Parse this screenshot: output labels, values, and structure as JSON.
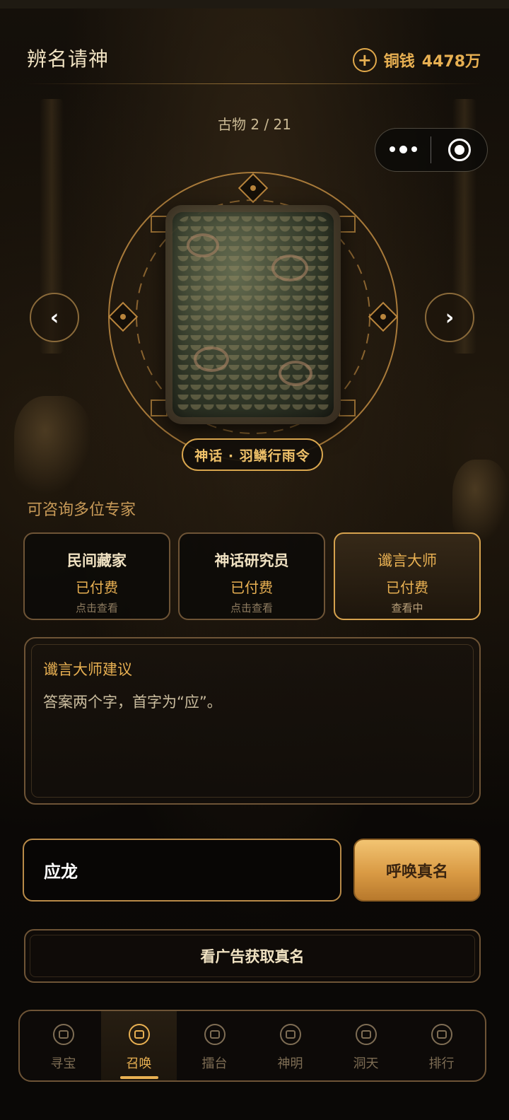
{
  "header": {
    "title": "辨名请神",
    "coins_label": "铜钱",
    "coins_value": "4478万"
  },
  "artifact": {
    "counter": "古物 2 / 21",
    "name": "神话 · 羽鳞行雨令"
  },
  "experts": {
    "section_label": "可咨询多位专家",
    "items": [
      {
        "name": "民间藏家",
        "status": "已付费",
        "action": "点击查看"
      },
      {
        "name": "神话研究员",
        "status": "已付费",
        "action": "点击查看"
      },
      {
        "name": "谶言大师",
        "status": "已付费",
        "action": "查看中"
      }
    ]
  },
  "advice": {
    "title": "谶言大师建议",
    "text": "答案两个字，首字为“应”。"
  },
  "answer": {
    "value": "应龙",
    "submit_label": "呼唤真名"
  },
  "ad": {
    "label": "看广告获取真名"
  },
  "tabbar": {
    "items": [
      {
        "label": "寻宝",
        "icon": "treasure-icon"
      },
      {
        "label": "召唤",
        "icon": "summon-icon"
      },
      {
        "label": "擂台",
        "icon": "arena-icon"
      },
      {
        "label": "神明",
        "icon": "deity-icon"
      },
      {
        "label": "洞天",
        "icon": "cave-icon"
      },
      {
        "label": "排行",
        "icon": "ranking-icon"
      }
    ],
    "active_index": 1
  },
  "colors": {
    "accent_gold": "#e8b052",
    "border_bronze": "#6e5436",
    "background": "#0c0906"
  }
}
